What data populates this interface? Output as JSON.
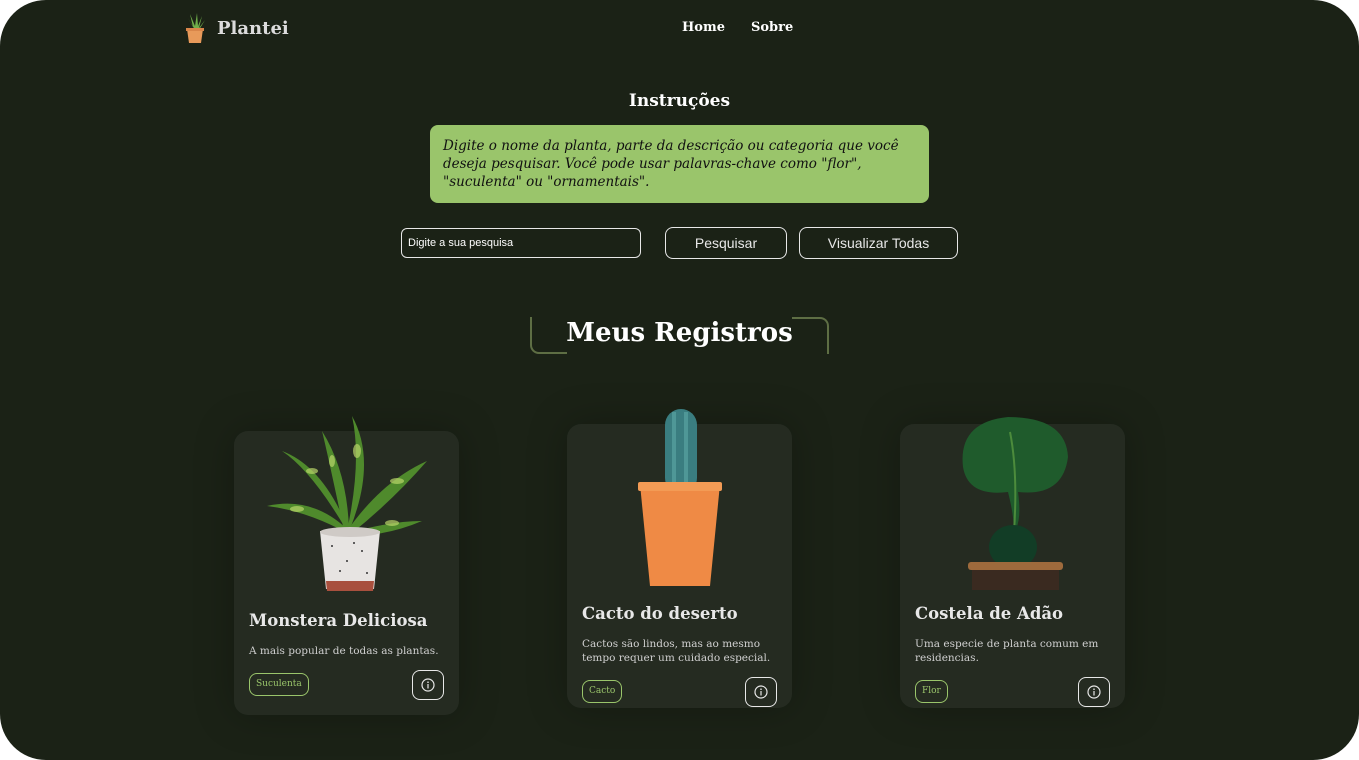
{
  "header": {
    "logo_text": "Plantei",
    "logo_icon": "potted-plant-icon",
    "nav": [
      "Home",
      "Sobre"
    ]
  },
  "instructions": {
    "title": "Instruções",
    "text": "Digite o nome da planta, parte da descrição ou categoria que você deseja pesquisar. Você pode usar palavras-chave como \"flor\", \"suculenta\" ou \"ornamentais\"."
  },
  "search": {
    "placeholder": "Digite a sua pesquisa",
    "search_button": "Pesquisar",
    "view_all_button": "Visualizar Todas"
  },
  "section": {
    "title": "Meus Registros"
  },
  "cards": [
    {
      "title": "Monstera Deliciosa",
      "description": "A mais popular de todas as plantas.",
      "tag": "Suculenta",
      "image": "dieffenbachia-plant-image"
    },
    {
      "title": "Cacto do deserto",
      "description": "Cactos são lindos, mas ao mesmo tempo requer um cuidado especial.",
      "tag": "Cacto",
      "image": "cactus-plant-image"
    },
    {
      "title": "Costela de Adão",
      "description": "Uma especie de planta comum em residencias.",
      "tag": "Flor",
      "image": "monstera-plant-image"
    }
  ],
  "colors": {
    "background": "#1b2216",
    "card": "#252b21",
    "accent": "#9ac56b"
  }
}
